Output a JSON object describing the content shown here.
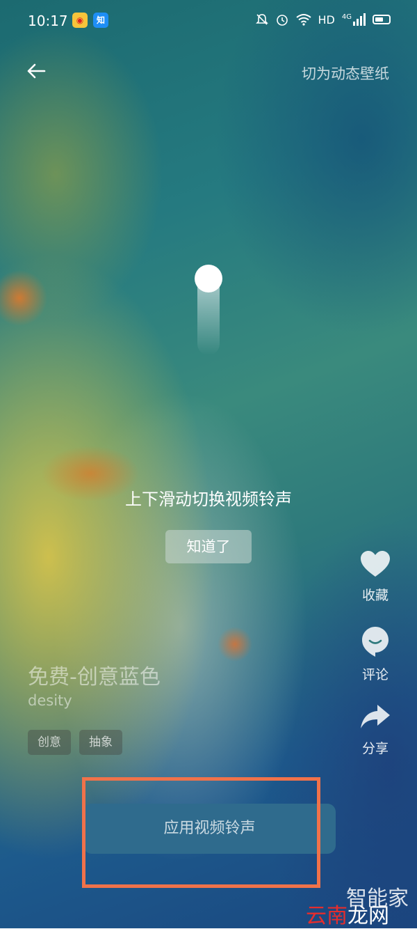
{
  "status_bar": {
    "time": "10:17",
    "icons": [
      "weibo-icon",
      "zhihu-icon",
      "bell-muted-icon",
      "alarm-icon",
      "wifi-icon",
      "signal-4g-icon",
      "battery-icon"
    ],
    "network_label": "HD",
    "signal_label": "4G",
    "zhihu_char": "知"
  },
  "topbar": {
    "back_icon": "arrow-left-icon",
    "action_label": "切为动态壁纸"
  },
  "overlay": {
    "hint": "上下滑动切换视频铃声",
    "dismiss_label": "知道了"
  },
  "side_actions": [
    {
      "icon": "heart-icon",
      "label": "收藏"
    },
    {
      "icon": "comment-icon",
      "label": "评论"
    },
    {
      "icon": "share-icon",
      "label": "分享"
    }
  ],
  "content": {
    "title": "免费-创意蓝色",
    "author": "desity",
    "tags": [
      "创意",
      "抽象"
    ]
  },
  "apply_button": {
    "label": "应用视频铃声"
  },
  "watermark": {
    "line1": "智能家",
    "line2_red": "云南",
    "line2_white": "龙网"
  },
  "colors": {
    "highlight": "#f0724a",
    "apply_button_bg": "#2f6b8d"
  }
}
